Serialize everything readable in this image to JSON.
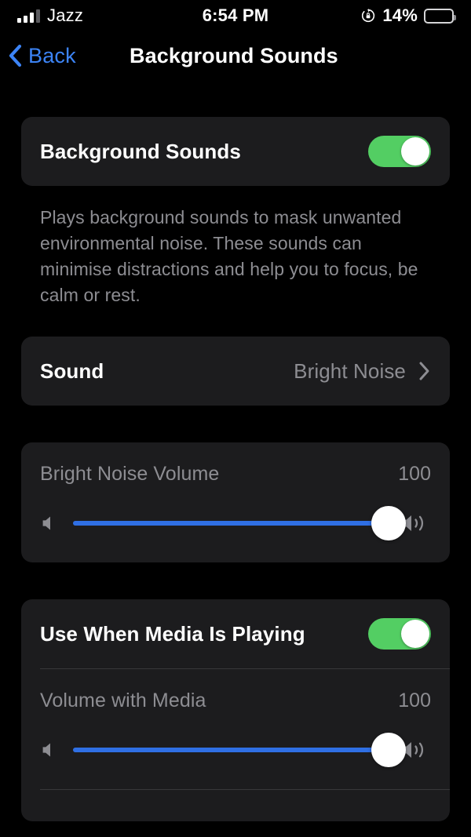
{
  "status_bar": {
    "carrier": "Jazz",
    "time": "6:54 PM",
    "battery_percent": "14%",
    "battery_level": 14,
    "battery_color": "#f5c518",
    "signal_bars_active": 3,
    "signal_bars_total": 4,
    "rotation_lock_icon": "rotation-lock-icon"
  },
  "nav": {
    "back_label": "Back",
    "back_icon": "chevron-left-icon",
    "title": "Background Sounds",
    "accent_color": "#3c84f6"
  },
  "main": {
    "background_sounds_row": {
      "label": "Background Sounds",
      "toggle_on": true
    },
    "description": "Plays background sounds to mask unwanted environmental noise. These sounds can minimise distractions and help you to focus, be calm or rest.",
    "sound_row": {
      "label": "Sound",
      "value": "Bright Noise",
      "chevron_icon": "chevron-right-icon"
    },
    "sound_volume_slider": {
      "label": "Bright Noise Volume",
      "value": "100",
      "percent": 100,
      "min_icon": "speaker-min-icon",
      "max_icon": "speaker-max-icon"
    },
    "media_row": {
      "label": "Use When Media Is Playing",
      "toggle_on": true
    },
    "media_volume_slider": {
      "label": "Volume with Media",
      "value": "100",
      "percent": 100,
      "min_icon": "speaker-min-icon",
      "max_icon": "speaker-max-icon"
    }
  },
  "theme": {
    "background": "#000000",
    "card": "#1c1c1e",
    "secondary_text": "#8d8d92",
    "toggle_on_color": "#53ce63",
    "slider_fill": "#2f6fe4",
    "separator": "#38383a"
  }
}
